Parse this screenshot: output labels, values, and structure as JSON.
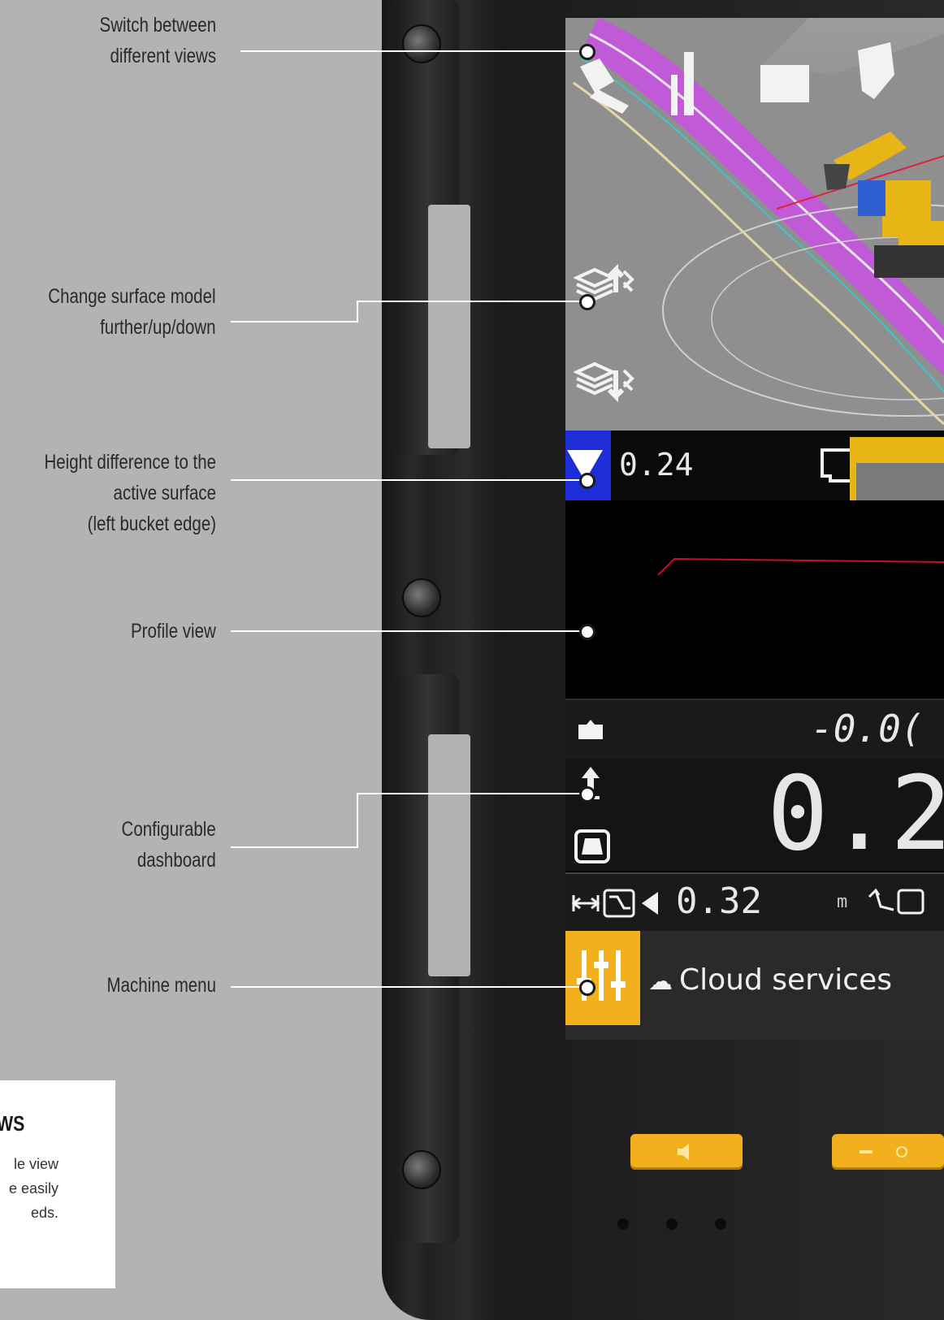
{
  "annotations": [
    {
      "lines": [
        "Switch between",
        "different views"
      ]
    },
    {
      "lines": [
        "Change surface model",
        "further/up/down"
      ]
    },
    {
      "lines": [
        "Height difference to the",
        "active surface",
        "(left bucket edge)"
      ]
    },
    {
      "lines": [
        "Profile view"
      ]
    },
    {
      "lines": [
        "Configurable",
        "dashboard"
      ]
    },
    {
      "lines": [
        "Machine menu"
      ]
    }
  ],
  "info_box": {
    "title": "WS",
    "body_lines": [
      "le view",
      "e easily",
      "eds."
    ]
  },
  "screen": {
    "height_difference": "0.24",
    "row1_value": "-0.0(",
    "dashboard_value": "0.2",
    "distance_value": "0.32",
    "distance_unit": "m",
    "cloud_label": "Cloud services"
  },
  "colors": {
    "accent_yellow": "#f1b01c",
    "height_indicator_blue": "#1e2ed6",
    "design_surface_magenta": "#c15ad6",
    "background_gray": "#b3b3b3"
  },
  "icons": [
    "view-switch-icon",
    "surface-up-icon",
    "surface-down-icon",
    "triangle-down-icon",
    "bucket-icon",
    "cut-fill-icon",
    "arrow-up-icon",
    "bucket-edge-icon",
    "distance-icon",
    "slope-icon",
    "machine-menu-icon",
    "cloud-icon",
    "speaker-icon",
    "brightness-icon"
  ]
}
